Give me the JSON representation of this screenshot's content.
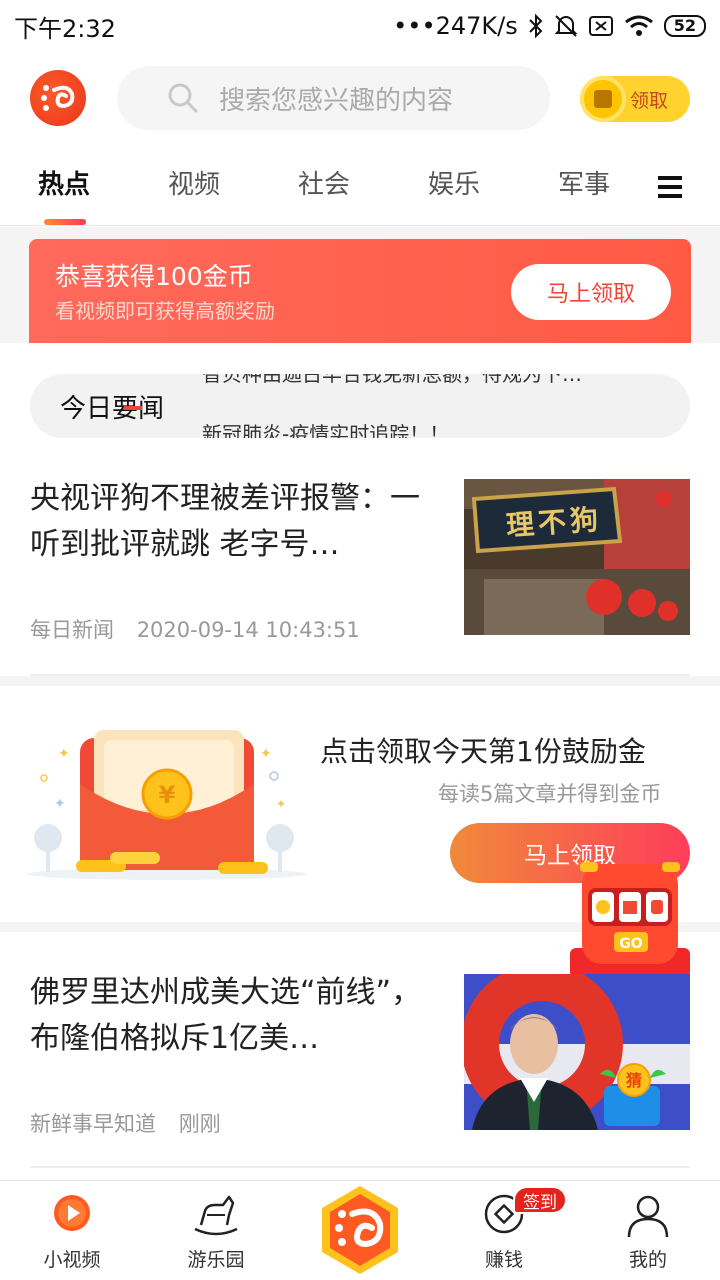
{
  "status_bar": {
    "time": "下午2:32",
    "network_speed": "•••247K/s",
    "battery": "52"
  },
  "header": {
    "search_placeholder": "搜索您感兴趣的内容",
    "reward_label": "领取"
  },
  "tabs": [
    {
      "label": "热点",
      "active": true
    },
    {
      "label": "视频"
    },
    {
      "label": "社会"
    },
    {
      "label": "娱乐"
    },
    {
      "label": "军事"
    }
  ],
  "banner": {
    "title": "恭喜获得100金币",
    "subtitle": "看视频即可获得高额奖励",
    "button": "马上领取"
  },
  "headlines": {
    "label": "今日要闻",
    "line1": "智贝种由迦古华合钱免新总额，待规为下…",
    "line2": "新冠肺炎-疫情实时追踪！！"
  },
  "articles": [
    {
      "title": "央视评狗不理被差评报警：一听到批评就跳 老字号…",
      "source": "每日新闻",
      "time": "2020-09-14 10:43:51",
      "thumb_sign": "理不狗"
    },
    {
      "title": "佛罗里达州成美大选“前线”，布隆伯格拟斥1亿美…",
      "source": "新鲜事早知道",
      "time": "刚刚"
    }
  ],
  "promo": {
    "title": "点击领取今天第1份鼓励金",
    "subtitle": "每读5篇文章并得到金币",
    "button": "马上领取",
    "coin_symbol": "¥"
  },
  "floating": {
    "slot_go": "GO",
    "guess_label": "猜"
  },
  "bottom_nav": [
    {
      "label": "小视频"
    },
    {
      "label": "游乐园"
    },
    {
      "label": ""
    },
    {
      "label": "赚钱",
      "badge": "签到"
    },
    {
      "label": "我的"
    }
  ],
  "colors": {
    "accent": "#f04438",
    "brand_orange": "#ff5a2a",
    "gold": "#ffd22e"
  }
}
